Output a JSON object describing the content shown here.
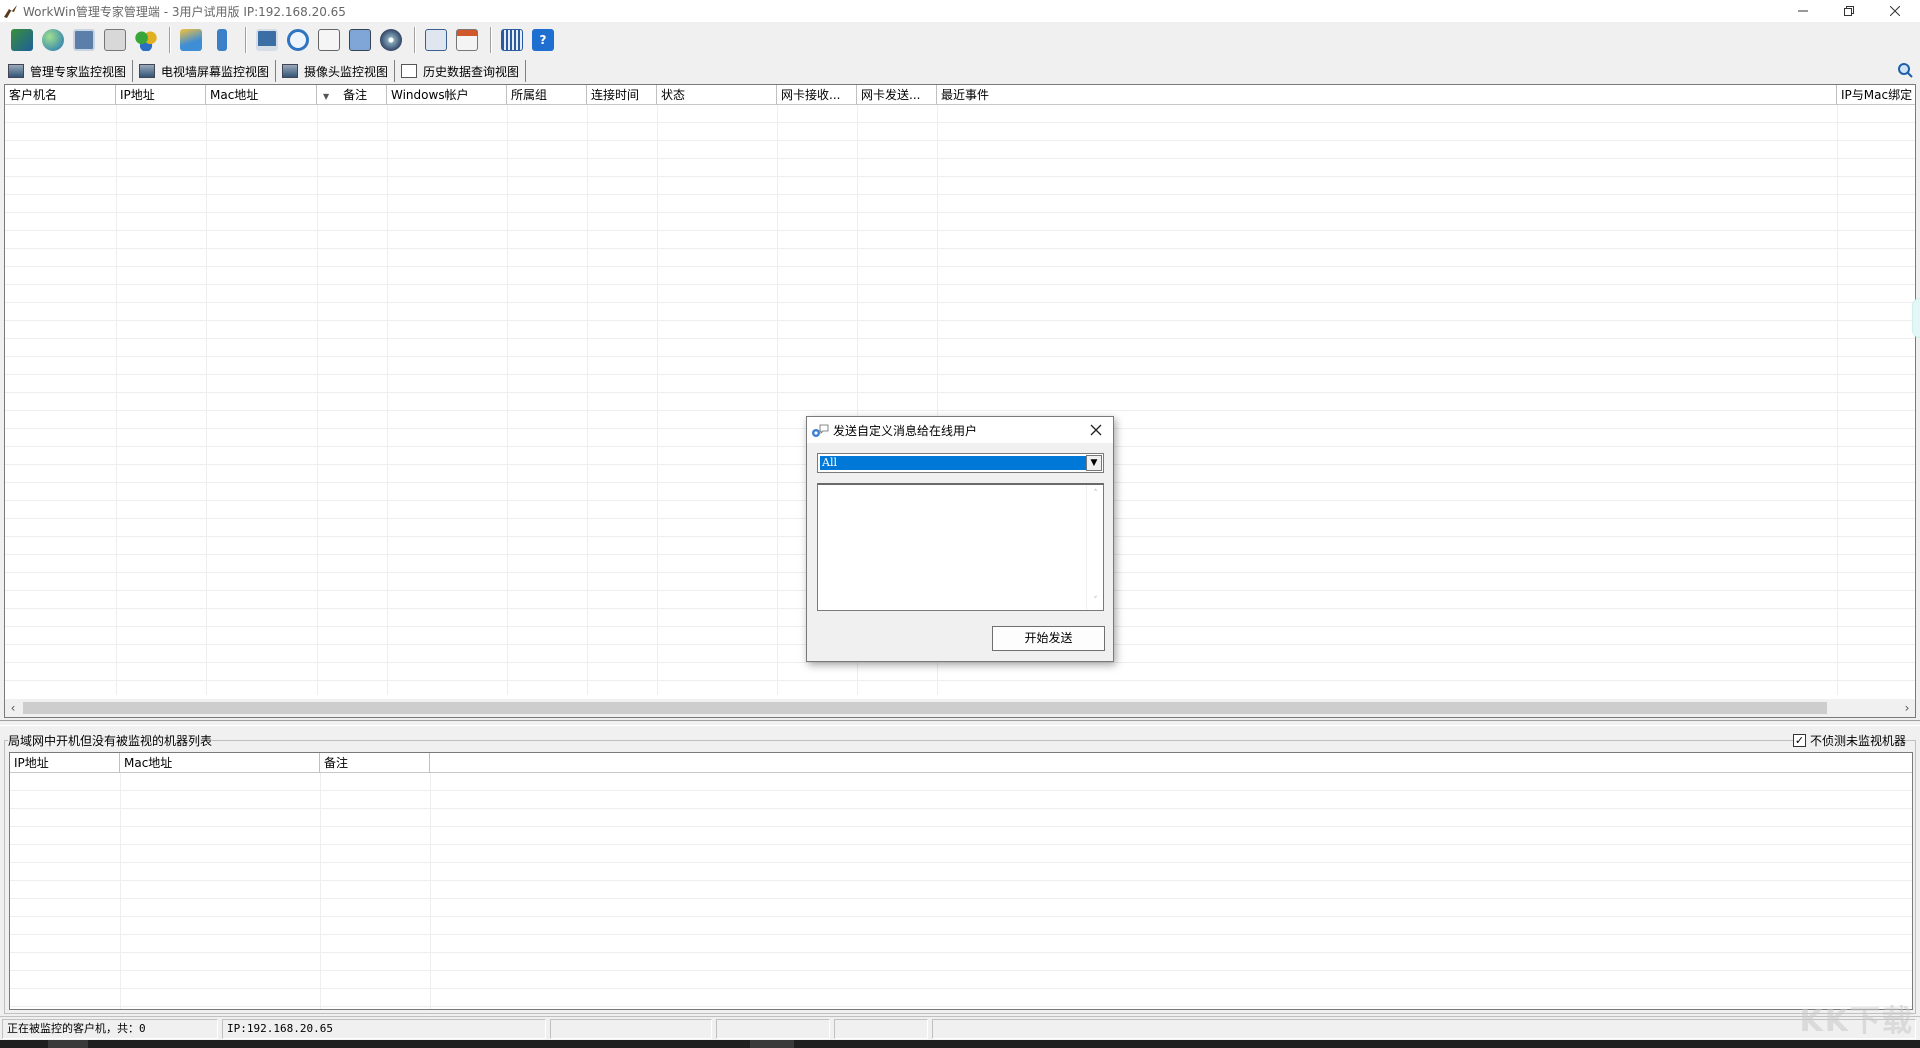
{
  "window": {
    "title": "WorkWin管理专家管理端 - 3用户试用版 IP:192.168.20.65"
  },
  "toolbar": {
    "buttons": [
      {
        "icon": "database-icon"
      },
      {
        "icon": "globe-icon"
      },
      {
        "icon": "settings-monitor-icon"
      },
      {
        "icon": "mail-icon"
      },
      {
        "icon": "users-icon"
      },
      {
        "icon": "chart-icon"
      },
      {
        "icon": "usb-icon"
      },
      {
        "icon": "remote-desktop-icon"
      },
      {
        "icon": "refresh-icon"
      },
      {
        "icon": "search-document-icon"
      },
      {
        "icon": "screens-icon"
      },
      {
        "icon": "disc-icon"
      },
      {
        "icon": "report-icon"
      },
      {
        "icon": "calendar-icon"
      },
      {
        "icon": "keyboard-icon"
      },
      {
        "icon": "help-icon"
      }
    ]
  },
  "view_tabs": [
    {
      "label": "管理专家监控视图"
    },
    {
      "label": "电视墙屏幕监控视图"
    },
    {
      "label": "摄像头监控视图"
    },
    {
      "label": "历史数据查询视图"
    }
  ],
  "main_grid": {
    "columns": [
      "客户机名",
      "IP地址",
      "Mac地址",
      "备注",
      "Windows帐户",
      "所属组",
      "连接时间",
      "状态",
      "网卡接收...",
      "网卡发送...",
      "最近事件",
      "IP与Mac绑定"
    ]
  },
  "bottom_panel": {
    "caption": "局域网中开机但没有被监视的机器列表",
    "checkbox_label": "不侦测未监视机器",
    "checkbox_checked": true,
    "columns": [
      "IP地址",
      "Mac地址",
      "备注"
    ]
  },
  "status_bar": {
    "monitored_text": "正在被监控的客户机，共：0",
    "ip_text": "IP:192.168.20.65"
  },
  "dialog": {
    "title": "发送自定义消息给在线用户",
    "recipient_selected": "All",
    "message_value": "",
    "send_label": "开始发送"
  }
}
